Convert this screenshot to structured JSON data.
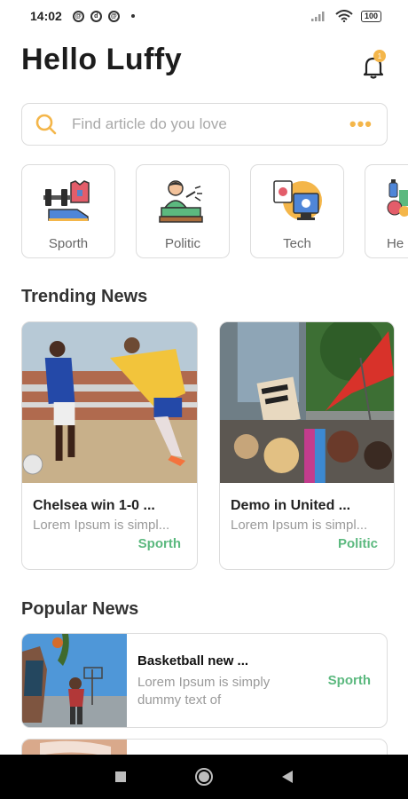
{
  "status_bar": {
    "time": "14:02",
    "battery": "100"
  },
  "header": {
    "greeting": "Hello Luffy",
    "notification_count": "1"
  },
  "search": {
    "placeholder": "Find article do you love"
  },
  "categories": [
    {
      "label": "Sporth",
      "icon": "sport-icon"
    },
    {
      "label": "Politic",
      "icon": "politician-icon"
    },
    {
      "label": "Tech",
      "icon": "computer-icon"
    },
    {
      "label": "He",
      "icon": "health-food-icon"
    }
  ],
  "trending": {
    "title": "Trending News",
    "items": [
      {
        "title": "Chelsea win 1-0 ...",
        "desc": "Lorem Ipsum is simpl...",
        "category": "Sporth"
      },
      {
        "title": "Demo in United ...",
        "desc": "Lorem Ipsum is simpl...",
        "category": "Politic"
      }
    ]
  },
  "popular": {
    "title": "Popular News",
    "items": [
      {
        "title": "Basketball new ...",
        "desc": "Lorem Ipsum is simply dummy text of",
        "category": "Sporth"
      }
    ]
  },
  "colors": {
    "accent": "#f4b64a",
    "category_green": "#5cb97f",
    "text_dark": "#1c1c1c",
    "border": "#dcdcdc"
  }
}
